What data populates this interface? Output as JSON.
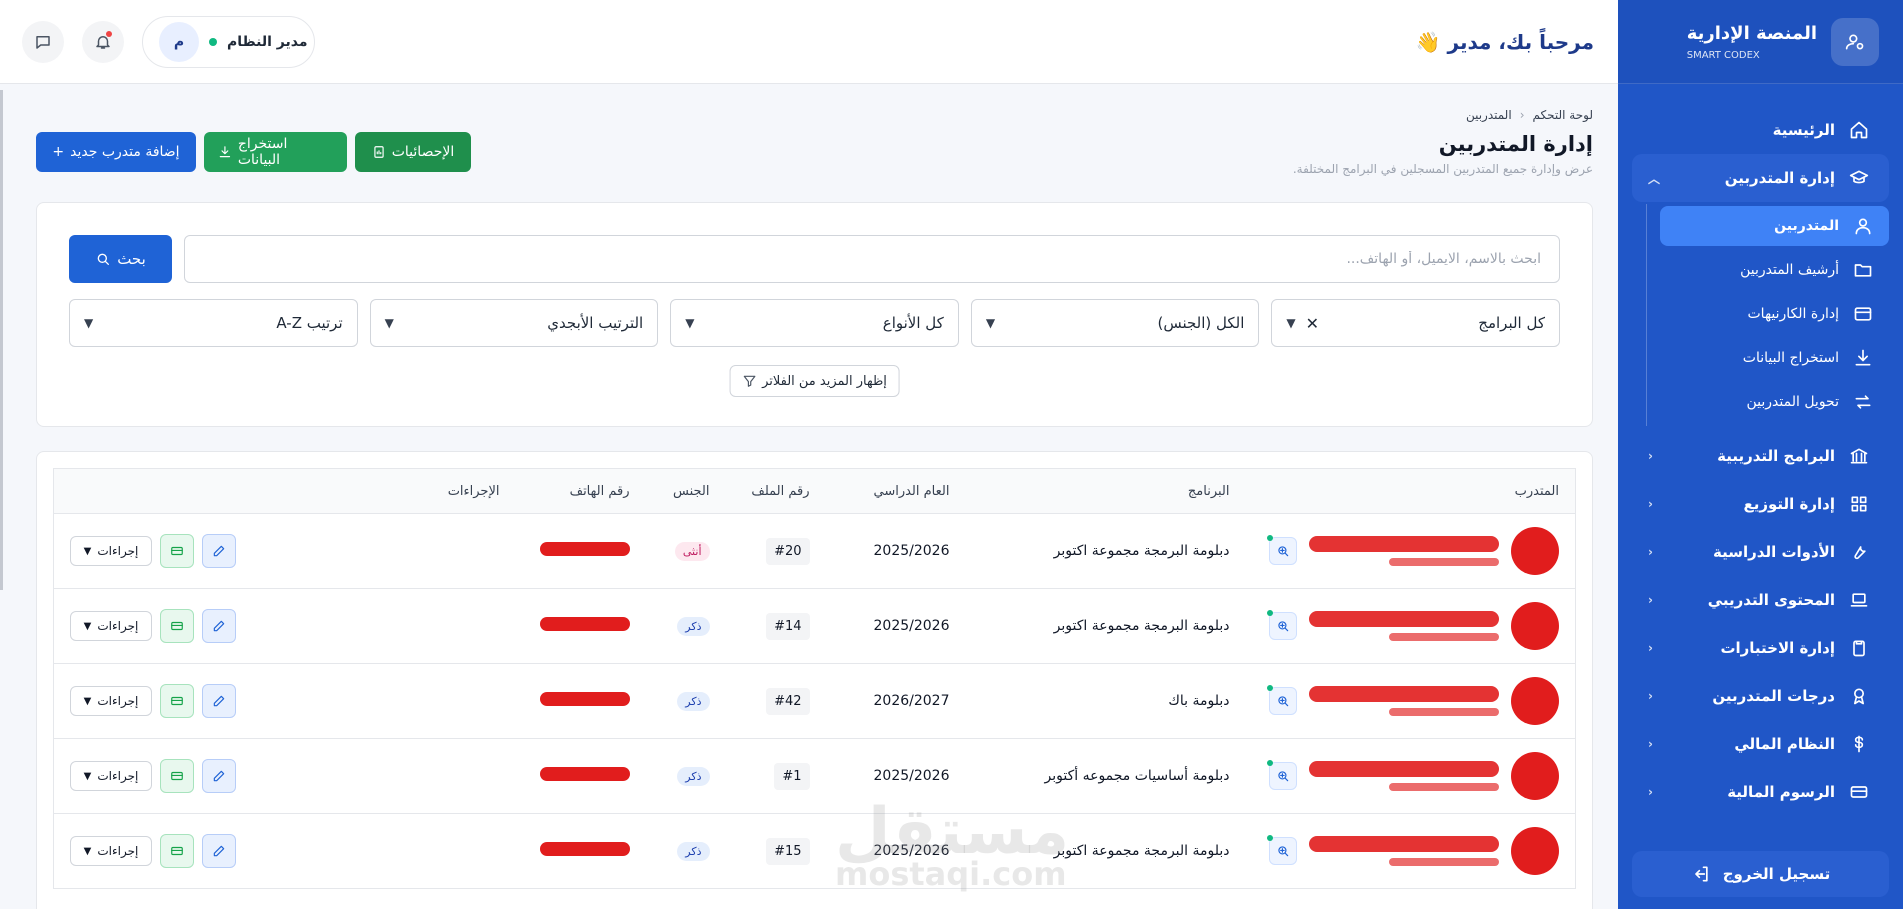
{
  "brand": {
    "title": "المنصة الإدارية",
    "subtitle": "SMART CODEX"
  },
  "header": {
    "welcome": "مرحباً بك، مدير 👋",
    "user_name": "مدير النظام",
    "user_initial": "م"
  },
  "sidebar": {
    "items": [
      {
        "label": "الرئيسية"
      },
      {
        "label": "إدارة المتدربين"
      },
      {
        "label": "البرامج التدريبية"
      },
      {
        "label": "إدارة التوزيع"
      },
      {
        "label": "الأدوات الدراسية"
      },
      {
        "label": "المحتوى التدريبي"
      },
      {
        "label": "إدارة الاختبارات"
      },
      {
        "label": "درجات المتدربين"
      },
      {
        "label": "النظام المالي"
      },
      {
        "label": "الرسوم المالية"
      }
    ],
    "sub_items": [
      {
        "label": "المتدربين"
      },
      {
        "label": "أرشيف المتدربين"
      },
      {
        "label": "إدارة الكارنيهات"
      },
      {
        "label": "استخراج البيانات"
      },
      {
        "label": "تحويل المتدربين"
      }
    ],
    "logout": "تسجيل الخروج"
  },
  "breadcrumb": {
    "home": "لوحة التحكم",
    "current": "المتدربين"
  },
  "page": {
    "title": "إدارة المتدربين",
    "description": "عرض وإدارة جميع المتدربين المسجلين في البرامج المختلفة."
  },
  "actions": {
    "stats": "الإحصائيات",
    "export": "استخراج البيانات",
    "add": "إضافة متدرب جديد"
  },
  "filters": {
    "search_placeholder": "ابحث بالاسم، الايميل، أو الهاتف...",
    "search_button": "بحث",
    "program": "كل البرامج",
    "gender": "الكل (الجنس)",
    "type": "كل الأنواع",
    "order": "الترتيب الأبجدي",
    "sort": "ترتيب A-Z",
    "more": "إظهار المزيد من الفلاتر"
  },
  "table": {
    "headers": {
      "trainee": "المتدرب",
      "program": "البرنامج",
      "year": "العام الدراسي",
      "file": "رقم الملف",
      "gender": "الجنس",
      "phone": "رقم الهاتف",
      "actions": "الإجراءات"
    },
    "action_label": "إجراءات",
    "rows": [
      {
        "program": "دبلومة البرمجة مجموعة اكتوبر",
        "year": "2025/2026",
        "file": "#20",
        "gender": "أنثى",
        "gender_type": "f"
      },
      {
        "program": "دبلومة البرمجة مجموعة اكتوبر",
        "year": "2025/2026",
        "file": "#14",
        "gender": "ذكر",
        "gender_type": "m"
      },
      {
        "program": "دبلومة باك",
        "year": "2026/2027",
        "file": "#42",
        "gender": "ذكر",
        "gender_type": "m"
      },
      {
        "program": "دبلومة أساسيات مجموعه أكتوبر",
        "year": "2025/2026",
        "file": "#1",
        "gender": "ذكر",
        "gender_type": "m"
      },
      {
        "program": "دبلومة البرمجة مجموعة اكتوبر",
        "year": "2025/2026",
        "file": "#15",
        "gender": "ذكر",
        "gender_type": "m"
      }
    ]
  },
  "watermark": {
    "text": "مستقل",
    "domain": "mostaqi.com"
  },
  "colors": {
    "sidebar": "#2056c7",
    "primary": "#1f63d6",
    "green": "#22a05a",
    "active": "#3f82f6"
  }
}
